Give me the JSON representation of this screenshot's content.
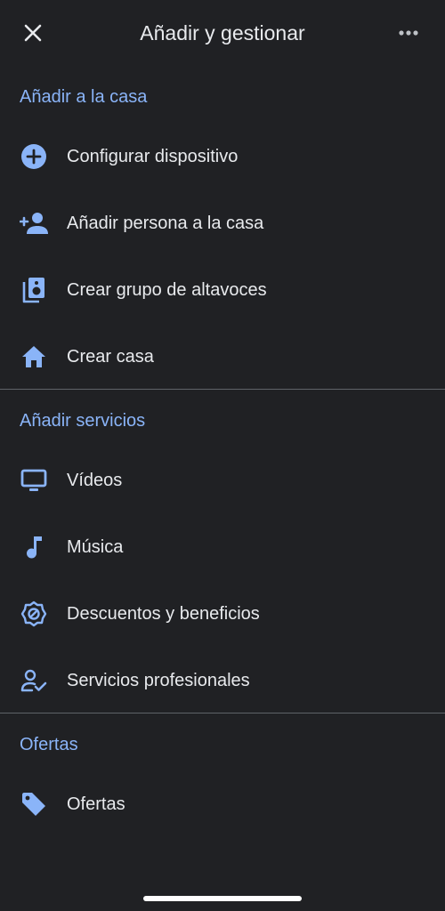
{
  "header": {
    "title": "Añadir y gestionar"
  },
  "sections": [
    {
      "title": "Añadir a la casa",
      "items": [
        {
          "label": "Configurar dispositivo",
          "icon": "add-circle-icon"
        },
        {
          "label": "Añadir persona a la casa",
          "icon": "add-person-icon"
        },
        {
          "label": "Crear grupo de altavoces",
          "icon": "speaker-group-icon"
        },
        {
          "label": "Crear casa",
          "icon": "home-icon"
        }
      ]
    },
    {
      "title": "Añadir servicios",
      "items": [
        {
          "label": "Vídeos",
          "icon": "tv-icon"
        },
        {
          "label": "Música",
          "icon": "music-note-icon"
        },
        {
          "label": "Descuentos y beneficios",
          "icon": "discount-badge-icon"
        },
        {
          "label": "Servicios profesionales",
          "icon": "person-check-icon"
        }
      ]
    },
    {
      "title": "Ofertas",
      "items": [
        {
          "label": "Ofertas",
          "icon": "tag-icon"
        }
      ]
    }
  ],
  "colors": {
    "background": "#202124",
    "accent": "#8ab4f8",
    "text": "#e8eaed",
    "divider": "#5f6368"
  }
}
